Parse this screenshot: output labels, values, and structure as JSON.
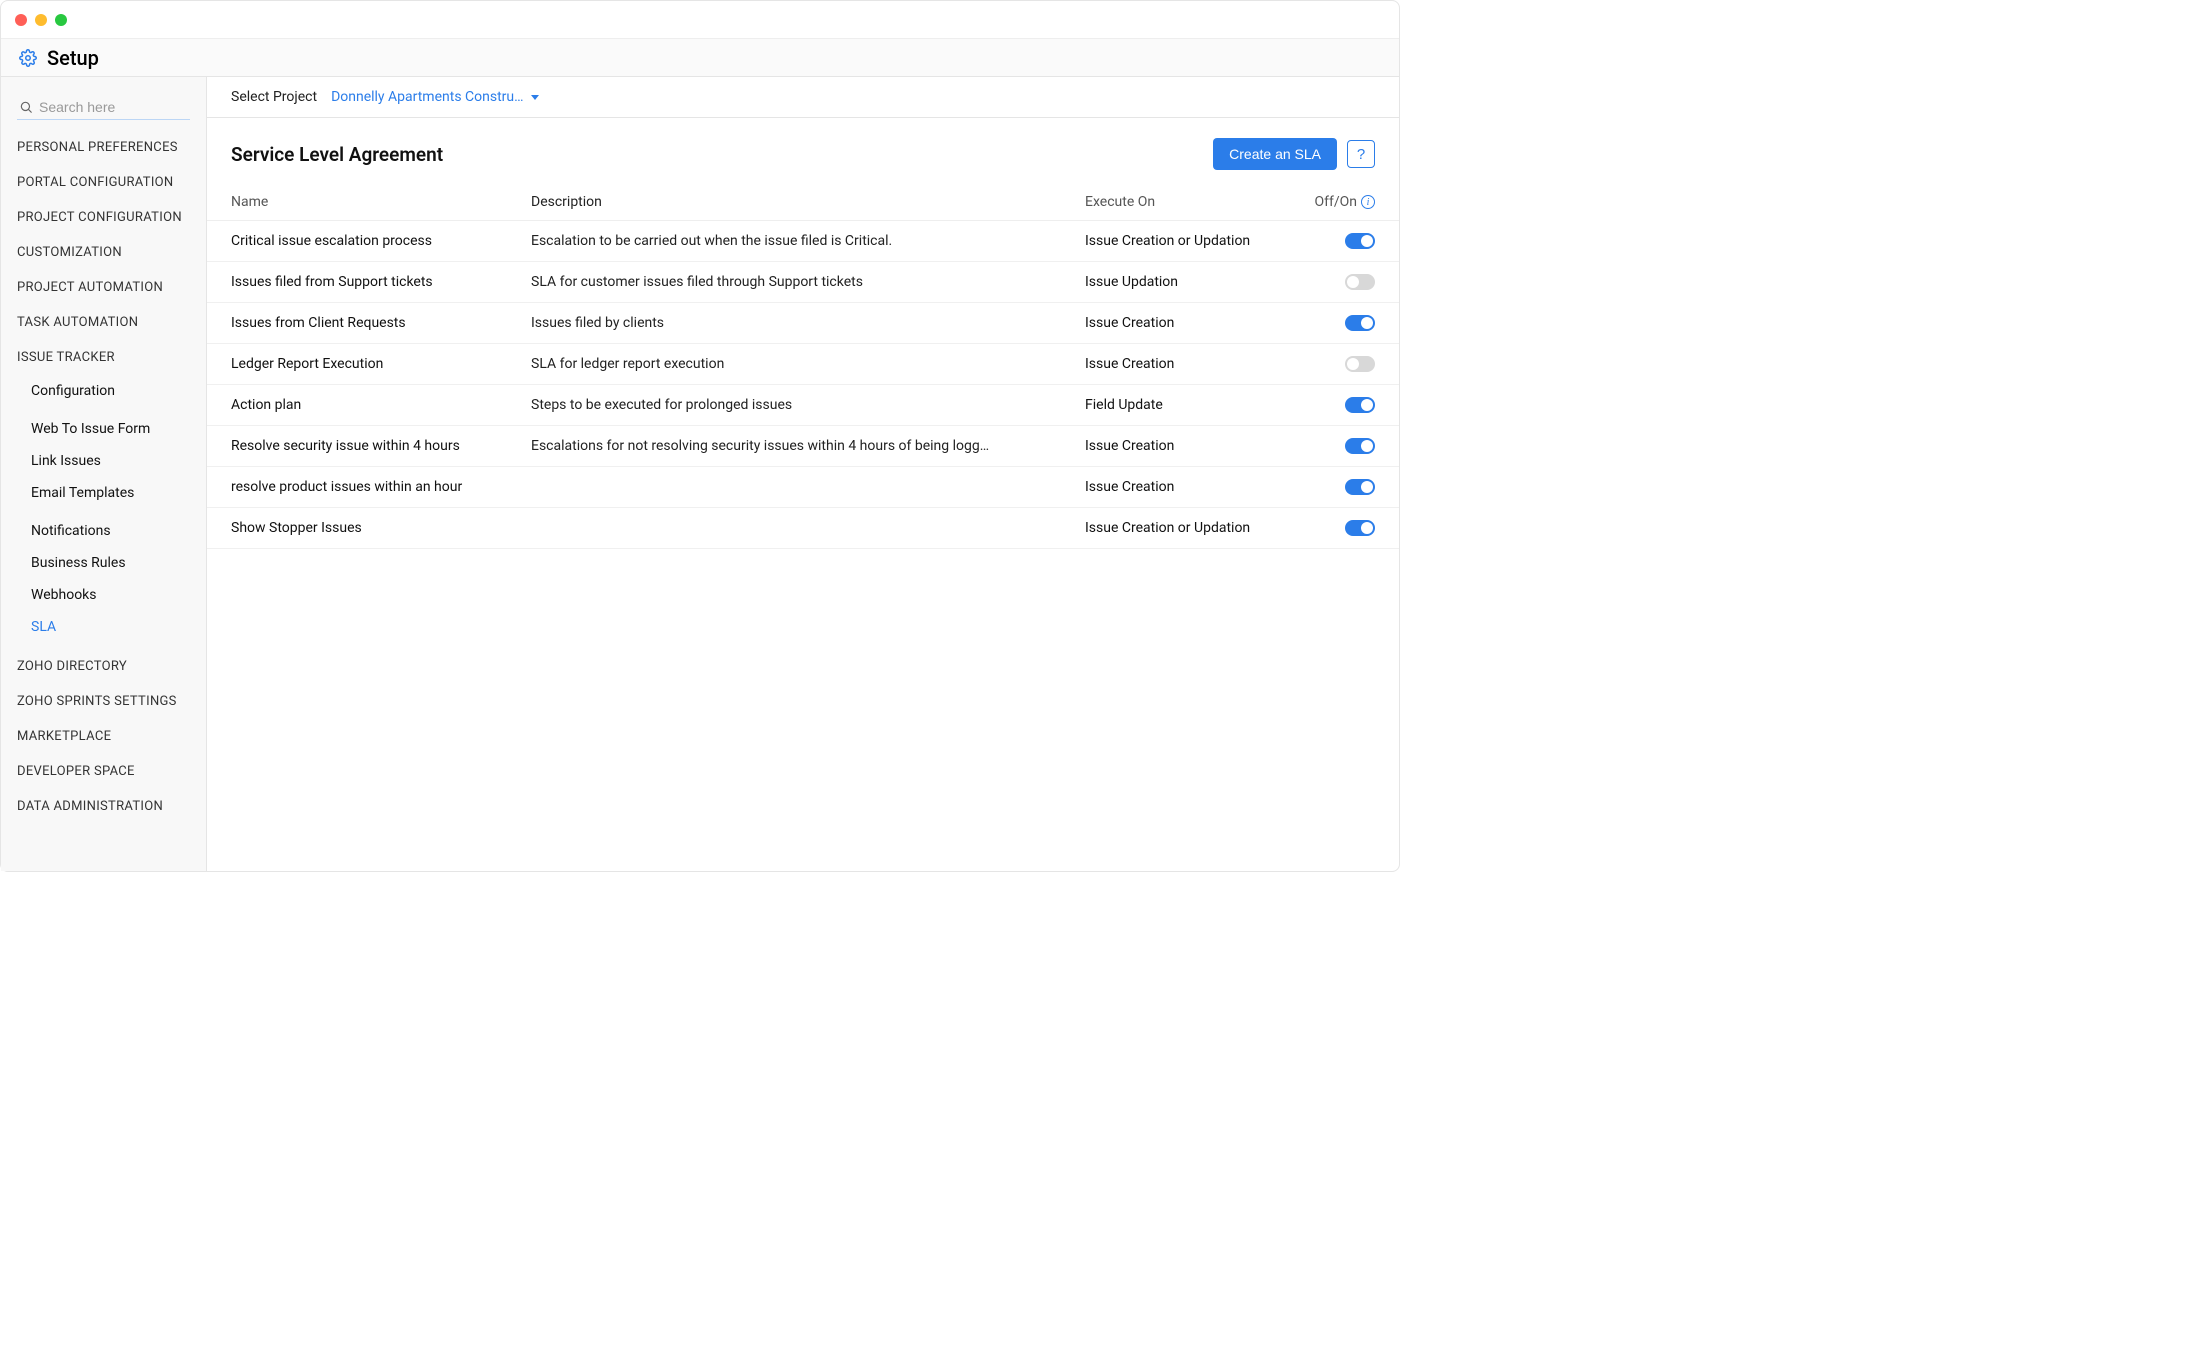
{
  "window": {
    "title": "Setup"
  },
  "search": {
    "placeholder": "Search here"
  },
  "sidebar": {
    "categories": [
      {
        "label": "PERSONAL PREFERENCES"
      },
      {
        "label": "PORTAL CONFIGURATION"
      },
      {
        "label": "PROJECT CONFIGURATION"
      },
      {
        "label": "CUSTOMIZATION"
      },
      {
        "label": "PROJECT AUTOMATION"
      },
      {
        "label": "TASK AUTOMATION"
      },
      {
        "label": "ISSUE TRACKER",
        "expanded": true,
        "items": [
          {
            "label": "Configuration"
          },
          {
            "label": "Web To Issue Form"
          },
          {
            "label": "Link Issues"
          },
          {
            "label": "Email Templates"
          },
          {
            "label": "Notifications"
          },
          {
            "label": "Business Rules"
          },
          {
            "label": "Webhooks"
          },
          {
            "label": "SLA",
            "active": true
          }
        ]
      },
      {
        "label": "ZOHO DIRECTORY"
      },
      {
        "label": "ZOHO SPRINTS SETTINGS"
      },
      {
        "label": "MARKETPLACE"
      },
      {
        "label": "DEVELOPER SPACE"
      },
      {
        "label": "DATA ADMINISTRATION"
      }
    ]
  },
  "project": {
    "label": "Select Project",
    "value": "Donnelly Apartments Constru…"
  },
  "page": {
    "title": "Service Level Agreement",
    "create_label": "Create an SLA",
    "help_label": "?"
  },
  "columns": {
    "name": "Name",
    "description": "Description",
    "execute_on": "Execute On",
    "off_on": "Off/On"
  },
  "rows": [
    {
      "name": "Critical issue escalation process",
      "description": "Escalation to be carried out when the issue filed is Critical.",
      "execute_on": "Issue Creation or Updation",
      "on": true
    },
    {
      "name": "Issues filed from Support tickets",
      "description": "SLA for customer issues filed through Support tickets",
      "execute_on": "Issue Updation",
      "on": false
    },
    {
      "name": "Issues from Client Requests",
      "description": "Issues filed by clients",
      "execute_on": "Issue Creation",
      "on": true
    },
    {
      "name": "Ledger Report Execution",
      "description": "SLA for ledger report execution",
      "execute_on": "Issue Creation",
      "on": false
    },
    {
      "name": "Action plan",
      "description": "Steps to be executed for prolonged issues",
      "execute_on": "Field Update",
      "on": true
    },
    {
      "name": "Resolve security issue within 4 hours",
      "description": "Escalations for not resolving security issues within 4 hours of being logg…",
      "execute_on": "Issue Creation",
      "on": true
    },
    {
      "name": "resolve product issues within an hour",
      "description": "",
      "execute_on": "Issue Creation",
      "on": true
    },
    {
      "name": "Show Stopper Issues",
      "description": "",
      "execute_on": "Issue Creation or Updation",
      "on": true
    }
  ]
}
